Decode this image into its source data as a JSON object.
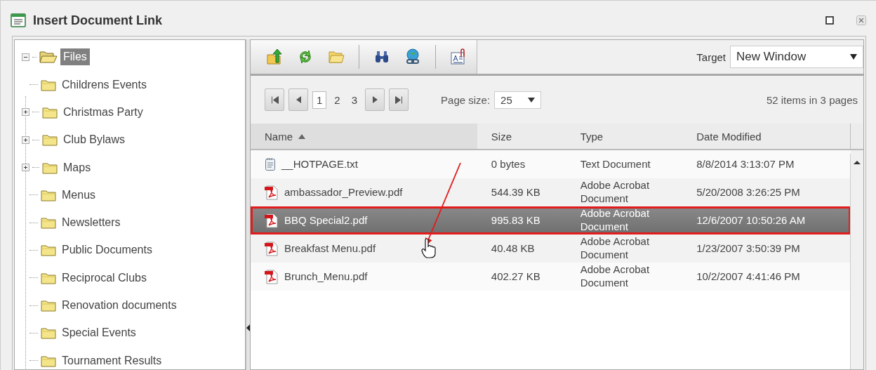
{
  "window": {
    "title": "Insert Document Link"
  },
  "tree": {
    "label": "Files",
    "expanded": true,
    "selected": true,
    "children": [
      {
        "label": "Childrens Events",
        "expandable": false
      },
      {
        "label": "Christmas Party",
        "expandable": true
      },
      {
        "label": "Club Bylaws",
        "expandable": true
      },
      {
        "label": "Maps",
        "expandable": true
      },
      {
        "label": "Menus",
        "expandable": false
      },
      {
        "label": "Newsletters",
        "expandable": false
      },
      {
        "label": "Public Documents",
        "expandable": false
      },
      {
        "label": "Reciprocal Clubs",
        "expandable": false
      },
      {
        "label": "Renovation documents",
        "expandable": false
      },
      {
        "label": "Special Events",
        "expandable": false
      },
      {
        "label": "Tournament Results",
        "expandable": false
      }
    ]
  },
  "toolbar": {
    "buttons": [
      {
        "kind": "upload"
      },
      {
        "kind": "refresh"
      },
      {
        "kind": "new-folder"
      },
      {
        "kind": "separator"
      },
      {
        "kind": "search"
      },
      {
        "kind": "link"
      },
      {
        "kind": "separator"
      },
      {
        "kind": "properties"
      }
    ],
    "target": {
      "label": "Target",
      "value": "New Window"
    }
  },
  "pager": {
    "pages": [
      {
        "label": "1",
        "selected": true
      },
      {
        "label": "2",
        "selected": false
      },
      {
        "label": "3",
        "selected": false
      }
    ],
    "page_size": {
      "label": "Page size:",
      "value": "25"
    },
    "summary": "52 items in 3 pages"
  },
  "table": {
    "columns": [
      {
        "label": "Name",
        "sorted": true
      },
      {
        "label": "Size",
        "sorted": false
      },
      {
        "label": "Type",
        "sorted": false
      },
      {
        "label": "Date Modified",
        "sorted": false
      }
    ],
    "rows": [
      {
        "kind": "text",
        "name": "__HOTPAGE.txt",
        "size": "0 bytes",
        "type": "Text Document",
        "date": "8/8/2014 3:13:07 PM",
        "selected": false
      },
      {
        "kind": "pdf",
        "name": "ambassador_Preview.pdf",
        "size": "544.39 KB",
        "type": "Adobe Acrobat Document",
        "date": "5/20/2008 3:26:25 PM",
        "selected": false
      },
      {
        "kind": "pdf",
        "name": "BBQ Special2.pdf",
        "size": "995.83 KB",
        "type": "Adobe Acrobat Document",
        "date": "12/6/2007 10:50:26 AM",
        "selected": true
      },
      {
        "kind": "pdf",
        "name": "Breakfast Menu.pdf",
        "size": "40.48 KB",
        "type": "Adobe Acrobat Document",
        "date": "1/23/2007 3:50:39 PM",
        "selected": false
      },
      {
        "kind": "pdf",
        "name": "Brunch_Menu.pdf",
        "size": "402.27 KB",
        "type": "Adobe Acrobat Document",
        "date": "10/2/2007 4:41:46 PM",
        "selected": false
      }
    ]
  }
}
